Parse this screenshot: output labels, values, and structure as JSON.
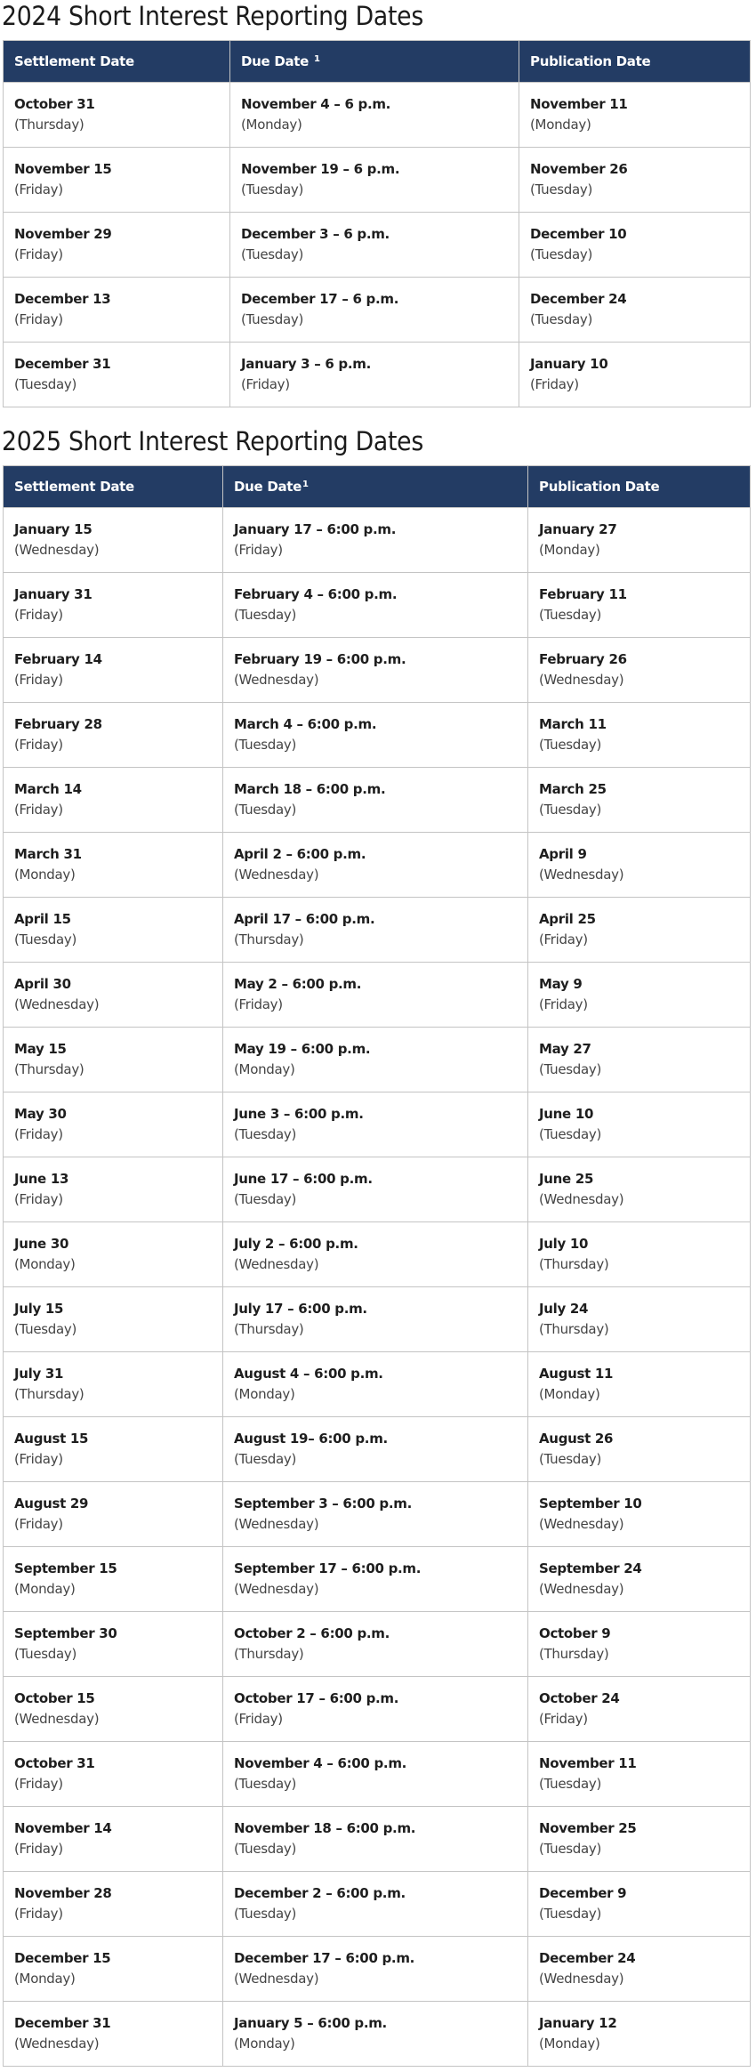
{
  "sections": [
    {
      "title": "2024 Short Interest Reporting Dates",
      "headers": {
        "settlement": "Settlement Date",
        "due": "Due Date",
        "due_sup": "1",
        "publication": "Publication Date"
      },
      "rows": [
        {
          "settlement": "October 31",
          "settlement_day": "(Thursday)",
          "due": "November 4 – 6 p.m.",
          "due_day": "(Monday)",
          "publication": "November 11",
          "publication_day": "(Monday)"
        },
        {
          "settlement": "November 15",
          "settlement_day": "(Friday)",
          "due": "November 19 – 6 p.m.",
          "due_day": "(Tuesday)",
          "publication": "November 26",
          "publication_day": "(Tuesday)"
        },
        {
          "settlement": "November 29",
          "settlement_day": "(Friday)",
          "due": "December 3 – 6 p.m.",
          "due_day": "(Tuesday)",
          "publication": "December 10",
          "publication_day": "(Tuesday)"
        },
        {
          "settlement": "December 13",
          "settlement_day": "(Friday)",
          "due": "December 17 – 6 p.m.",
          "due_day": "(Tuesday)",
          "publication": "December 24",
          "publication_day": "(Tuesday)"
        },
        {
          "settlement": "December 31",
          "settlement_day": "(Tuesday)",
          "due": "January 3 – 6 p.m.",
          "due_day": "(Friday)",
          "publication": "January 10",
          "publication_day": "(Friday)"
        }
      ]
    },
    {
      "title": "2025 Short Interest Reporting Dates",
      "headers": {
        "settlement": "Settlement Date",
        "due": "Due Date",
        "due_sup": "1",
        "publication": "Publication Date"
      },
      "rows": [
        {
          "settlement": "January 15",
          "settlement_day": "(Wednesday)",
          "due": "January 17 – 6:00 p.m.",
          "due_day": "(Friday)",
          "publication": "January 27",
          "publication_day": "(Monday)"
        },
        {
          "settlement": "January 31",
          "settlement_day": "(Friday)",
          "due": "February 4 – 6:00 p.m.",
          "due_day": "(Tuesday)",
          "publication": "February 11",
          "publication_day": "(Tuesday)"
        },
        {
          "settlement": "February 14",
          "settlement_day": "(Friday)",
          "due": "February 19 – 6:00 p.m.",
          "due_day": "(Wednesday)",
          "publication": "February 26",
          "publication_day": "(Wednesday)"
        },
        {
          "settlement": "February 28",
          "settlement_day": "(Friday)",
          "due": "March 4 – 6:00 p.m.",
          "due_day": "(Tuesday)",
          "publication": "March 11",
          "publication_day": "(Tuesday)"
        },
        {
          "settlement": "March 14",
          "settlement_day": "(Friday)",
          "due": "March 18 – 6:00 p.m.",
          "due_day": "(Tuesday)",
          "publication": "March 25",
          "publication_day": "(Tuesday)"
        },
        {
          "settlement": "March 31",
          "settlement_day": "(Monday)",
          "due": "April 2 – 6:00 p.m.",
          "due_day": "(Wednesday)",
          "publication": "April 9",
          "publication_day": "(Wednesday)"
        },
        {
          "settlement": "April 15",
          "settlement_day": "(Tuesday)",
          "due": "April 17 – 6:00 p.m.",
          "due_day": "(Thursday)",
          "publication": "April 25",
          "publication_day": "(Friday)"
        },
        {
          "settlement": "April 30",
          "settlement_day": "(Wednesday)",
          "due": "May 2 – 6:00 p.m.",
          "due_day": "(Friday)",
          "publication": "May 9",
          "publication_day": "(Friday)"
        },
        {
          "settlement": "May 15",
          "settlement_day": "(Thursday)",
          "due": "May 19 – 6:00 p.m.",
          "due_day": "(Monday)",
          "publication": "May 27",
          "publication_day": "(Tuesday)"
        },
        {
          "settlement": "May 30",
          "settlement_day": "(Friday)",
          "due": "June 3 – 6:00 p.m.",
          "due_day": "(Tuesday)",
          "publication": "June 10",
          "publication_day": "(Tuesday)"
        },
        {
          "settlement": "June 13",
          "settlement_day": "(Friday)",
          "due": "June 17 – 6:00 p.m.",
          "due_day": "(Tuesday)",
          "publication": "June 25",
          "publication_day": "(Wednesday)"
        },
        {
          "settlement": "June 30",
          "settlement_day": "(Monday)",
          "due": "July 2 – 6:00 p.m.",
          "due_day": "(Wednesday)",
          "publication": "July 10",
          "publication_day": "(Thursday)"
        },
        {
          "settlement": "July 15",
          "settlement_day": "(Tuesday)",
          "due": "July 17 – 6:00 p.m.",
          "due_day": "(Thursday)",
          "publication": "July 24",
          "publication_day": "(Thursday)"
        },
        {
          "settlement": "July 31",
          "settlement_day": "(Thursday)",
          "due": "August 4 – 6:00 p.m.",
          "due_day": "(Monday)",
          "publication": "August 11",
          "publication_day": "(Monday)"
        },
        {
          "settlement": "August 15",
          "settlement_day": "(Friday)",
          "due": "August 19– 6:00 p.m.",
          "due_day": "(Tuesday)",
          "publication": "August 26",
          "publication_day": "(Tuesday)"
        },
        {
          "settlement": "August 29",
          "settlement_day": "(Friday)",
          "due": "September 3 – 6:00 p.m.",
          "due_day": "(Wednesday)",
          "publication": "September 10",
          "publication_day": "(Wednesday)"
        },
        {
          "settlement": "September 15",
          "settlement_day": "(Monday)",
          "due": "September 17 – 6:00 p.m.",
          "due_day": "(Wednesday)",
          "publication": "September 24",
          "publication_day": "(Wednesday)"
        },
        {
          "settlement": "September 30",
          "settlement_day": "(Tuesday)",
          "due": "October 2 – 6:00 p.m.",
          "due_day": "(Thursday)",
          "publication": "October 9",
          "publication_day": "(Thursday)"
        },
        {
          "settlement": "October 15",
          "settlement_day": "(Wednesday)",
          "due": "October 17 – 6:00 p.m.",
          "due_day": "(Friday)",
          "publication": "October 24",
          "publication_day": "(Friday)"
        },
        {
          "settlement": "October 31",
          "settlement_day": "(Friday)",
          "due": "November 4 – 6:00 p.m.",
          "due_day": "(Tuesday)",
          "publication": "November 11",
          "publication_day": "(Tuesday)"
        },
        {
          "settlement": "November 14",
          "settlement_day": "(Friday)",
          "due": "November 18 – 6:00 p.m.",
          "due_day": "(Tuesday)",
          "publication": "November 25",
          "publication_day": "(Tuesday)"
        },
        {
          "settlement": "November 28",
          "settlement_day": "(Friday)",
          "due": "December 2 – 6:00 p.m.",
          "due_day": "(Tuesday)",
          "publication": "December 9",
          "publication_day": "(Tuesday)"
        },
        {
          "settlement": "December 15",
          "settlement_day": "(Monday)",
          "due": "December 17 – 6:00 p.m.",
          "due_day": "(Wednesday)",
          "publication": "December 24",
          "publication_day": "(Wednesday)"
        },
        {
          "settlement": "December 31",
          "settlement_day": "(Wednesday)",
          "due": "January 5 – 6:00 p.m.",
          "due_day": "(Monday)",
          "publication": "January 12",
          "publication_day": "(Monday)"
        }
      ]
    }
  ]
}
